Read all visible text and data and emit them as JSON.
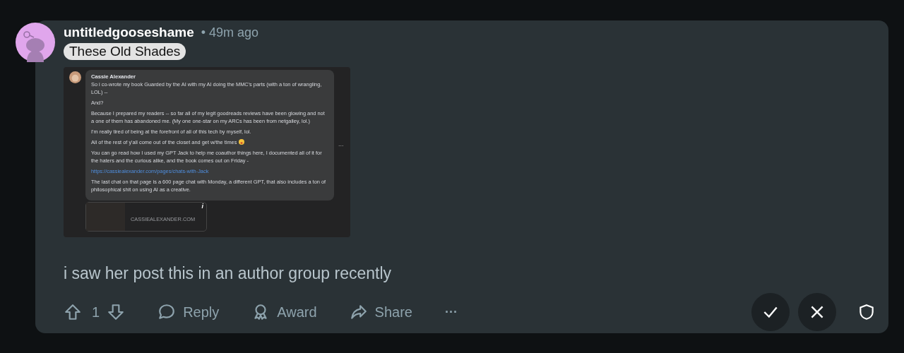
{
  "comment": {
    "author": "untitledgooseshame",
    "time": "• 49m ago",
    "flair": "These Old Shades",
    "body": "i saw her post this in an author group recently"
  },
  "embedded_post": {
    "author": "Cassie Alexander",
    "paragraphs": [
      {
        "kind": "text",
        "text": "So i co-wrote my book Guarded by the AI with my AI doing the MMC's parts (with a ton of wrangling, LOL) --"
      },
      {
        "kind": "text",
        "text": "And?"
      },
      {
        "kind": "text",
        "text": "Because I prepared my readers -- so far all of my legit goodreads reviews have been glowing and not a one of them has abandoned me. (My one one-star on my ARCs has been from netgalley, lol.)"
      },
      {
        "kind": "text",
        "text": "I'm really tired of being at the forefront of all of this tech by myself, lol."
      },
      {
        "kind": "text",
        "text": "All of the rest of y'all come out of the closet and get w/the times",
        "emoji": true
      },
      {
        "kind": "text",
        "text": "You can go read how I used my GPT Jack to help me coauthor things here, I documented all of it for the haters and the curious alike, and the book comes out on Friday -"
      },
      {
        "kind": "link",
        "text": "https://cassiealexander.com/pages/chats-with-Jack"
      },
      {
        "kind": "text",
        "text": "The last chat on that page is a 600 page chat with Monday, a different GPT, that also includes a ton of philosophical shit on using AI as a creative."
      }
    ],
    "more": "...",
    "link_card": {
      "domain": "CASSIEALEXANDER.COM",
      "info": "i"
    }
  },
  "votes": {
    "count": "1"
  },
  "actions": [
    {
      "kind": "reply",
      "label": "Reply"
    },
    {
      "kind": "award",
      "label": "Award"
    },
    {
      "kind": "share",
      "label": "Share"
    },
    {
      "kind": "more",
      "label": "···"
    }
  ]
}
